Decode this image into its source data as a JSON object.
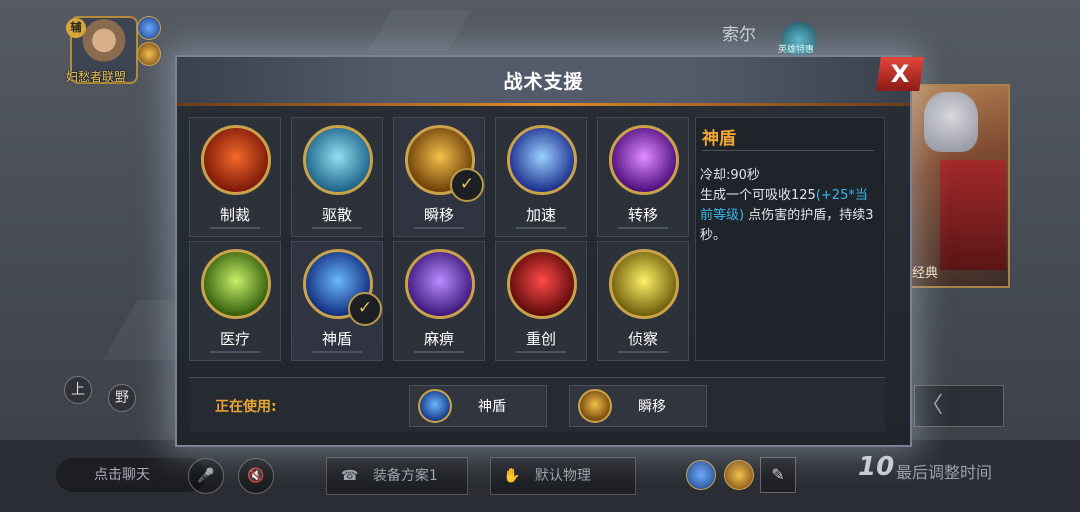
{
  "background": {
    "avatar_badge": "辅",
    "avatar_name": "妇愁者联盟",
    "player_name": "索尔",
    "lobby_label": "英雄特惠",
    "hero_card_label": "经典",
    "lane_top": "上",
    "lane_jungle": "野",
    "back_glyph": "〈"
  },
  "bottom_bar": {
    "chat_label": "点击聊天",
    "equipment_label": "装备方案1",
    "default_label": "默认物理",
    "timer_value": "10",
    "timer_label": "最后调整时间"
  },
  "dialog": {
    "title": "战术支援",
    "close_glyph": "X",
    "skills": [
      {
        "name": "制裁",
        "icon": "sanction-icon",
        "selected": false,
        "colors": [
          "#f26a2a",
          "#7a1608"
        ]
      },
      {
        "name": "驱散",
        "icon": "dispel-icon",
        "selected": false,
        "colors": [
          "#8fe0f0",
          "#1b5f86"
        ]
      },
      {
        "name": "瞬移",
        "icon": "blink-icon",
        "selected": true,
        "colors": [
          "#f2c14a",
          "#6b3b08"
        ]
      },
      {
        "name": "加速",
        "icon": "haste-icon",
        "selected": false,
        "colors": [
          "#9ad0ff",
          "#1a2a8a"
        ]
      },
      {
        "name": "转移",
        "icon": "transfer-icon",
        "selected": false,
        "colors": [
          "#e08cff",
          "#4a0a7a"
        ]
      },
      {
        "name": "医疗",
        "icon": "heal-icon",
        "selected": false,
        "colors": [
          "#c8f06a",
          "#2f5a08"
        ]
      },
      {
        "name": "神盾",
        "icon": "aegis-icon",
        "selected": true,
        "colors": [
          "#6ab8ff",
          "#0f2a7a"
        ]
      },
      {
        "name": "麻痹",
        "icon": "paralyze-icon",
        "selected": false,
        "colors": [
          "#b88cff",
          "#3a1578"
        ]
      },
      {
        "name": "重创",
        "icon": "wound-icon",
        "selected": false,
        "colors": [
          "#ff4a4a",
          "#5a0808"
        ]
      },
      {
        "name": "侦察",
        "icon": "scout-icon",
        "selected": false,
        "colors": [
          "#fff06a",
          "#6a5a08"
        ]
      }
    ],
    "detail": {
      "title": "神盾",
      "cooldown": "冷却:90秒",
      "desc_before": "生成一个可吸收125",
      "desc_highlight": "(+25*当前等级)",
      "desc_after": " 点伤害的护盾，持续3秒。"
    },
    "in_use": {
      "label": "正在使用:",
      "slots": [
        {
          "name": "神盾",
          "icon": "aegis-icon",
          "colors": [
            "#6ab8ff",
            "#0f2a7a"
          ]
        },
        {
          "name": "瞬移",
          "icon": "blink-icon",
          "colors": [
            "#f2c14a",
            "#6b3b08"
          ]
        }
      ]
    }
  }
}
